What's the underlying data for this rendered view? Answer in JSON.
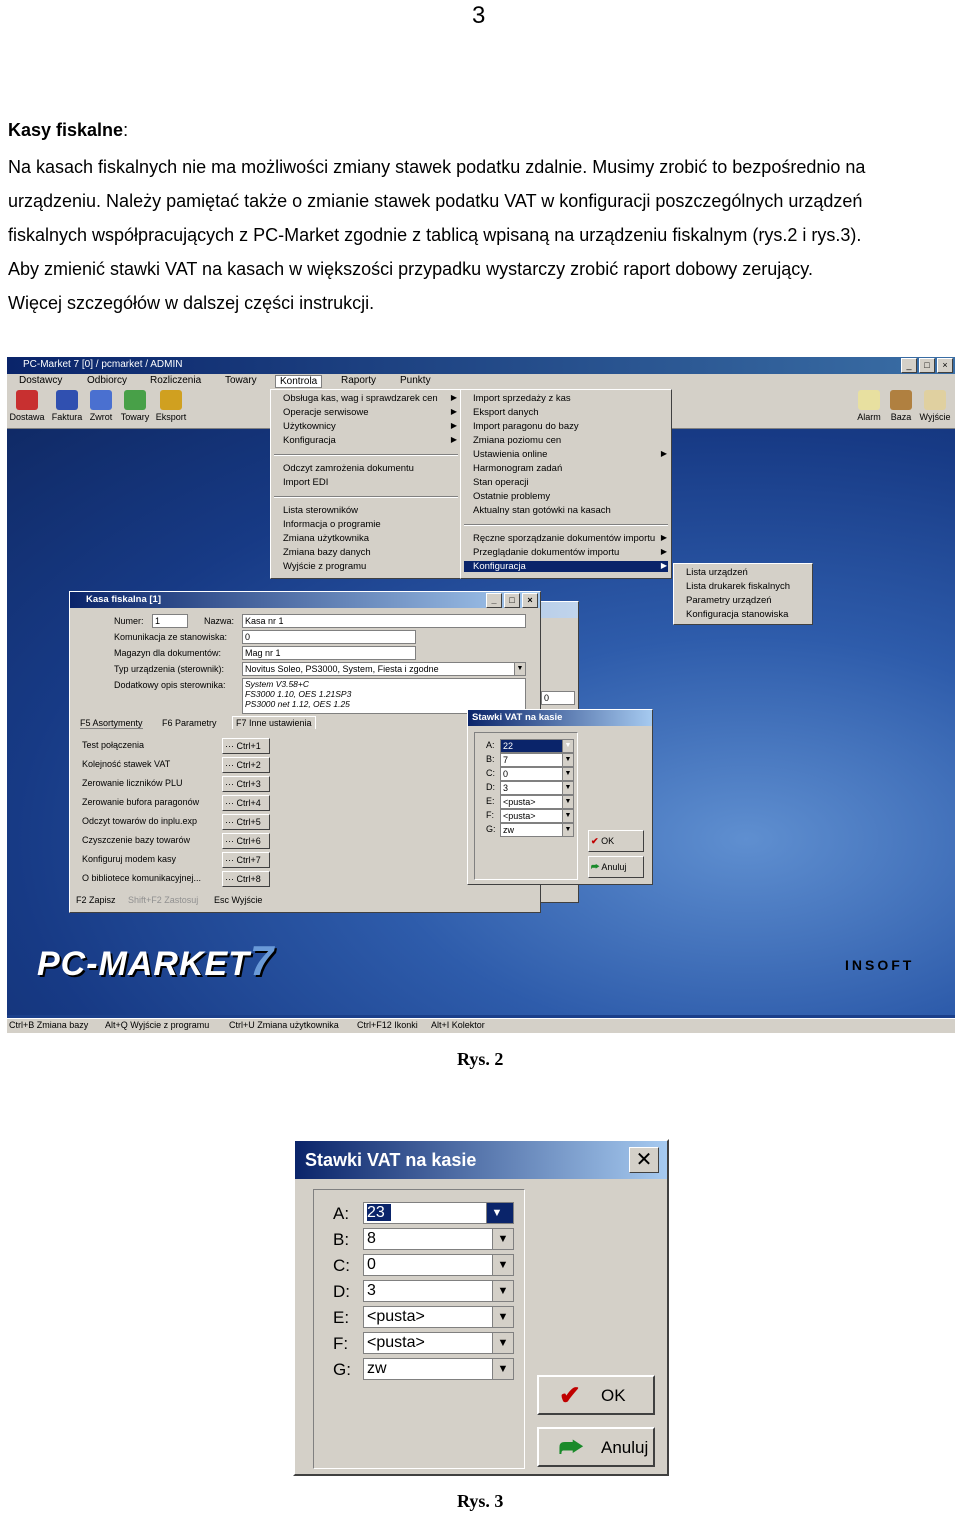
{
  "page_number": "3",
  "heading": {
    "bold": "Kasy fiskalne",
    "rest": ":"
  },
  "paragraph_lines": [
    "Na kasach fiskalnych nie ma możliwości zmiany stawek podatku zdalnie. Musimy zrobić to bezpośrednio na",
    "urządzeniu. Należy pamiętać także o zmianie stawek podatku VAT  w konfiguracji poszczególnych urządzeń",
    "fiskalnych współpracujących z PC-Market zgodnie z tablicą wpisaną na urządzeniu fiskalnym (rys.2 i rys.3).",
    "Aby zmienić stawki VAT na kasach w większości przypadku wystarczy zrobić raport dobowy zerujący.",
    "Więcej szczegółów w dalszej części instrukcji."
  ],
  "fig1": {
    "window_title": "PC-Market 7 [0] / pcmarket / ADMIN",
    "menu": [
      "Dostawcy",
      "Odbiorcy",
      "Rozliczenia",
      "Towary",
      "Kontrola",
      "Raporty",
      "Punkty"
    ],
    "toolbar_left": [
      "Dostawa",
      "Faktura",
      "Zwrot",
      "Towary",
      "Eksport"
    ],
    "toolbar_right": [
      "Alarm",
      "Baza",
      "Wyjście"
    ],
    "menu1": [
      "Obsługa kas, wag i sprawdzarek cen",
      "Operacje serwisowe",
      "Użytkownicy",
      "Konfiguracja",
      "Odczyt zamrożenia dokumentu",
      "Import EDI",
      "Lista sterowników",
      "Informacja o programie",
      "Zmiana użytkownika",
      "Zmiana bazy danych",
      "Wyjście z programu"
    ],
    "menu2": [
      "Import sprzedaży z kas",
      "Eksport danych",
      "Import paragonu do bazy",
      "Zmiana poziomu cen",
      "Ustawienia online",
      "Harmonogram zadań",
      "Stan operacji",
      "Ostatnie problemy",
      "Aktualny stan gotówki na kasach",
      "Ręczne sporządzanie dokumentów importu",
      "Przeglądanie dokumentów importu",
      "Konfiguracja"
    ],
    "menu3": [
      "Lista urządzeń",
      "Lista drukarek fiskalnych",
      "Parametry urządzeń",
      "Konfiguracja stanowiska"
    ],
    "kasa": {
      "title": "Kasa fiskalna [1]",
      "numer_label": "Numer:",
      "numer": "1",
      "nazwa_label": "Nazwa:",
      "nazwa": "Kasa nr 1",
      "kom_label": "Komunikacja ze stanowiska:",
      "kom": "0",
      "mag_label": "Magazyn dla dokumentów:",
      "mag": "Mag nr 1",
      "typ_label": "Typ urządzenia (sterownik):",
      "typ": "Novitus Soleo, PS3000, System, Fiesta i zgodne",
      "opis_label": "Dodatkowy opis sterownika:",
      "opis": [
        "System V3.58+C",
        "FS3000 1.10, OES 1.21SP3",
        "PS3000 net 1.12, OES 1.25"
      ],
      "tabs": [
        "F5  Asortymenty",
        "F6  Parametry",
        "F7  Inne ustawienia"
      ],
      "actions": [
        "Test połączenia",
        "Kolejność stawek VAT",
        "Zerowanie liczników PLU",
        "Zerowanie bufora paragonów",
        "Odczyt towarów do inplu.exp",
        "Czyszczenie bazy towarów",
        "Konfiguruj modem kasy",
        "O bibliotece komunikacyjnej..."
      ],
      "shortcuts": [
        "Ctrl+1",
        "Ctrl+2",
        "Ctrl+3",
        "Ctrl+4",
        "Ctrl+5",
        "Ctrl+6",
        "Ctrl+7",
        "Ctrl+8"
      ],
      "footer": [
        "F2  Zapisz",
        "Shift+F2  Zastosuj",
        "Esc  Wyjście"
      ],
      "side_value": "0"
    },
    "stawki_small": {
      "title": "Stawki VAT na kasie",
      "rows": [
        [
          "A:",
          "22"
        ],
        [
          "B:",
          "7"
        ],
        [
          "C:",
          "0"
        ],
        [
          "D:",
          "3"
        ],
        [
          "E:",
          "<pusta>"
        ],
        [
          "F:",
          "<pusta>"
        ],
        [
          "G:",
          "zw"
        ]
      ],
      "ok": "OK",
      "cancel": "Anuluj"
    },
    "logo_text": "PC-MARKET",
    "logo_num": "7",
    "brand": "INSOFT",
    "status": [
      "Ctrl+B  Zmiana bazy",
      "Alt+Q  Wyjście z programu",
      "Ctrl+U  Zmiana użytkownika",
      "Ctrl+F12  Ikonki",
      "Alt+I  Kolektor"
    ]
  },
  "caption1": "Rys. 2",
  "fig2": {
    "title": "Stawki VAT na kasie",
    "rows": [
      [
        "A:",
        "23"
      ],
      [
        "B:",
        "8"
      ],
      [
        "C:",
        "0"
      ],
      [
        "D:",
        "3"
      ],
      [
        "E:",
        "<pusta>"
      ],
      [
        "F:",
        "<pusta>"
      ],
      [
        "G:",
        "zw"
      ]
    ],
    "ok": "OK",
    "cancel": "Anuluj"
  },
  "caption2": "Rys. 3",
  "colors": {
    "titlebar": "#0a246a",
    "face": "#d4d0c8",
    "desktop": "#2e5cab",
    "ok_check": "#c00000",
    "exit_green": "#1a8a2a"
  }
}
